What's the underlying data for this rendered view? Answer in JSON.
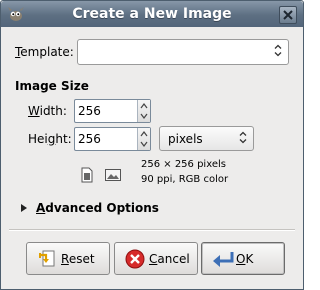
{
  "window": {
    "title": "Create a New Image",
    "app_icon": "gimp-wilber-icon",
    "close_icon": "close-icon"
  },
  "template": {
    "label_prefix": "",
    "label_mnemonic": "T",
    "label_rest": "emplate:",
    "value": ""
  },
  "image_size": {
    "heading": "Image Size",
    "width": {
      "label_mnemonic": "W",
      "label_rest": "idth:",
      "value": "256"
    },
    "height": {
      "label_prefix": "Hei",
      "label_mnemonic": "g",
      "label_rest": "ht:",
      "value": "256"
    },
    "unit": "pixels",
    "info_line1": "256 × 256 pixels",
    "info_line2": "90 ppi, RGB color",
    "portrait_icon": "portrait-orientation-icon",
    "landscape_icon": "landscape-orientation-icon"
  },
  "advanced": {
    "label_mnemonic": "A",
    "label_rest": "dvanced Options"
  },
  "buttons": {
    "reset": {
      "mnemonic": "R",
      "rest": "eset",
      "icon": "reset-icon"
    },
    "cancel": {
      "mnemonic": "C",
      "rest": "ancel",
      "icon": "cancel-icon"
    },
    "ok": {
      "mnemonic": "O",
      "rest": "K",
      "icon": "ok-icon"
    }
  },
  "colors": {
    "titlebar": "#5d6f82",
    "dialog_bg": "#edeceb",
    "cancel_red": "#d62b2b",
    "ok_blue": "#3d6fb6"
  }
}
